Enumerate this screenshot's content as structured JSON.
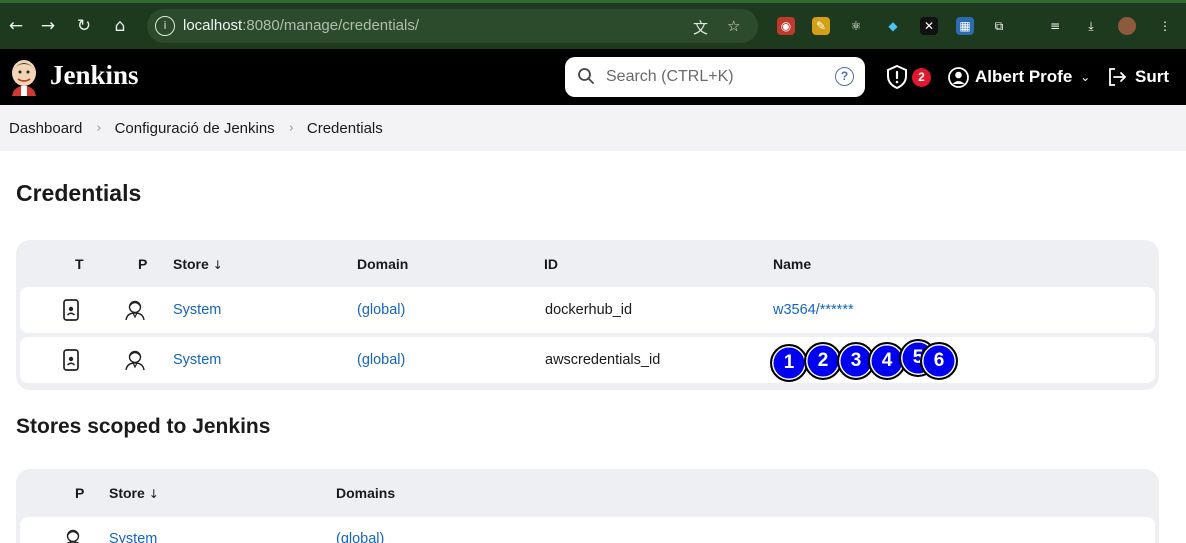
{
  "browser": {
    "url_host": "localhost",
    "url_rest": ":8080/manage/credentials/"
  },
  "header": {
    "brand": "Jenkins",
    "search_placeholder": "Search (CTRL+K)",
    "help_glyph": "?",
    "security_count": "2",
    "user_name": "Albert Profe",
    "logout_label": "Surt"
  },
  "breadcrumb": {
    "items": [
      "Dashboard",
      "Configuració de Jenkins",
      "Credentials"
    ]
  },
  "credentials": {
    "title": "Credentials",
    "headers": {
      "t": "T",
      "p": "P",
      "store": "Store",
      "sort": "↓",
      "domain": "Domain",
      "id": "ID",
      "name": "Name"
    },
    "rows": [
      {
        "type_icon": "credential-device-icon",
        "provider_icon": "user-bust-icon",
        "store": "System",
        "domain": "(global)",
        "id": "dockerhub_id",
        "name": "w3564/******"
      },
      {
        "type_icon": "credential-device-icon",
        "provider_icon": "user-bust-icon",
        "store": "System",
        "domain": "(global)",
        "id": "awscredentials_id",
        "name": ""
      }
    ]
  },
  "markers": [
    "1",
    "2",
    "3",
    "4",
    "5",
    "6"
  ],
  "stores": {
    "title": "Stores scoped to Jenkins",
    "headers": {
      "p": "P",
      "store": "Store",
      "sort": "↓",
      "domains": "Domains"
    },
    "rows": [
      {
        "provider_icon": "user-bust-icon",
        "store": "System",
        "domains": "(global)"
      }
    ]
  },
  "colors": {
    "link": "#1565c0",
    "header_bg": "#000000",
    "badge": "#e0182d",
    "marker": "#0000ee"
  }
}
